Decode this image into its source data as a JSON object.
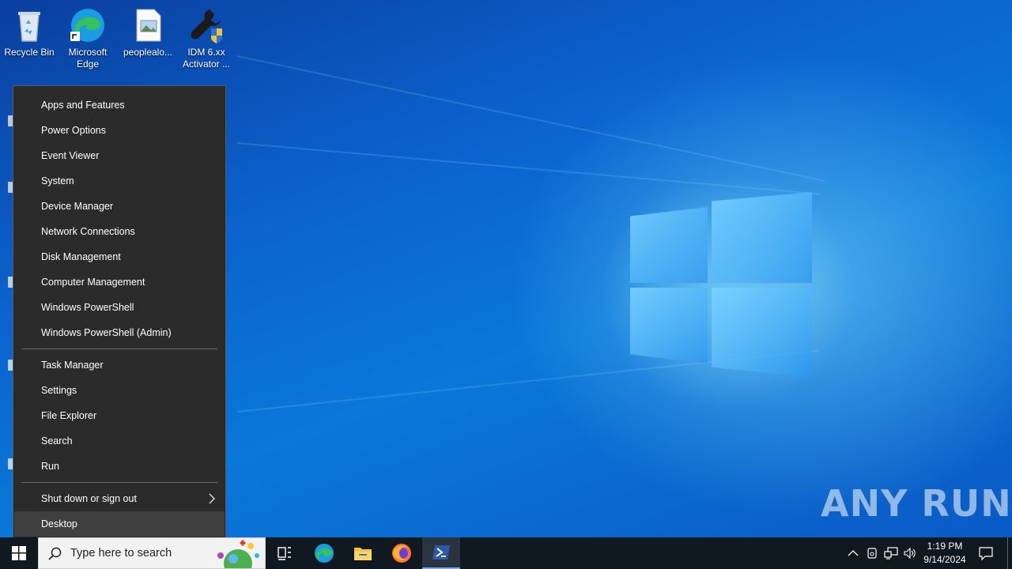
{
  "desktop_icons": [
    {
      "label_line1": "Recycle Bin",
      "label_line2": "",
      "icon": "recycle-bin-icon"
    },
    {
      "label_line1": "Microsoft",
      "label_line2": "Edge",
      "icon": "edge-icon"
    },
    {
      "label_line1": "peoplealo...",
      "label_line2": "",
      "icon": "image-file-icon"
    },
    {
      "label_line1": "IDM 6.xx",
      "label_line2": "Activator ...",
      "icon": "idm-activator-icon"
    }
  ],
  "context_menu": {
    "group1": [
      "Apps and Features",
      "Power Options",
      "Event Viewer",
      "System",
      "Device Manager",
      "Network Connections",
      "Disk Management",
      "Computer Management",
      "Windows PowerShell",
      "Windows PowerShell (Admin)"
    ],
    "group2": [
      "Task Manager",
      "Settings",
      "File Explorer",
      "Search",
      "Run"
    ],
    "group3": [
      "Shut down or sign out",
      "Desktop"
    ],
    "submenu_item": "Shut down or sign out",
    "active_item": "Desktop"
  },
  "taskbar": {
    "search_placeholder": "Type here to search",
    "apps": [
      "start-icon",
      "task-view-icon",
      "edge-icon",
      "file-explorer-icon",
      "firefox-icon",
      "powershell-icon"
    ],
    "clock_time": "1:19 PM",
    "clock_date": "9/14/2024"
  },
  "watermark": "ANY RUN",
  "colors": {
    "menu_bg": "#2b2b2b",
    "taskbar_bg": "#101820",
    "desktop_blue": "#0a78d8"
  }
}
